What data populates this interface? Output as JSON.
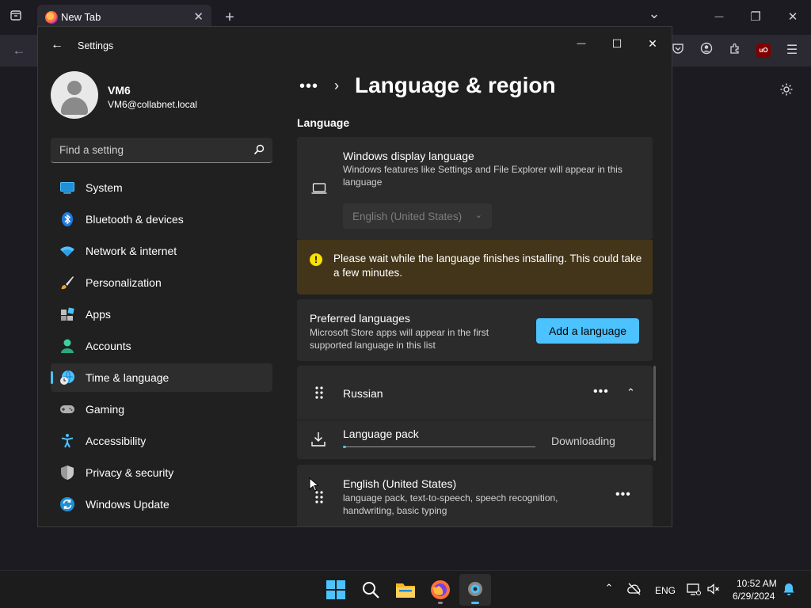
{
  "browser": {
    "tab_title": "New Tab",
    "tab_close": "✕",
    "new_tab": "+",
    "list_all_tabs": "⌄",
    "minimize": "—",
    "restore": "❐",
    "close": "✕",
    "back": "←",
    "menu": "☰",
    "ublock_label": "uO"
  },
  "settings": {
    "window_title": "Settings",
    "back": "←",
    "minimize": "—",
    "maximize": "☐",
    "close": "✕",
    "user": {
      "name": "VM6",
      "email": "VM6@collabnet.local"
    },
    "search": {
      "placeholder": "Find a setting"
    },
    "nav": [
      {
        "label": "System",
        "icon": "system-icon"
      },
      {
        "label": "Bluetooth & devices",
        "icon": "bluetooth-icon"
      },
      {
        "label": "Network & internet",
        "icon": "wifi-icon"
      },
      {
        "label": "Personalization",
        "icon": "brush-icon"
      },
      {
        "label": "Apps",
        "icon": "apps-icon"
      },
      {
        "label": "Accounts",
        "icon": "accounts-icon"
      },
      {
        "label": "Time & language",
        "icon": "time-language-icon",
        "active": true
      },
      {
        "label": "Gaming",
        "icon": "gamepad-icon"
      },
      {
        "label": "Accessibility",
        "icon": "accessibility-icon"
      },
      {
        "label": "Privacy & security",
        "icon": "shield-icon"
      },
      {
        "label": "Windows Update",
        "icon": "update-icon"
      }
    ],
    "breadcrumb": {
      "more": "•••",
      "separator": "›"
    },
    "page_title": "Language & region",
    "section_language": "Language",
    "display_language": {
      "title": "Windows display language",
      "description": "Windows features like Settings and File Explorer will appear in this language",
      "selected": "English (United States)"
    },
    "warning": "Please wait while the language finishes installing. This could take a few minutes.",
    "preferred": {
      "title": "Preferred languages",
      "description": "Microsoft Store apps will appear in the first supported language in this list",
      "add_button": "Add a language"
    },
    "languages": [
      {
        "name": "Russian",
        "pack_label": "Language pack",
        "pack_status": "Downloading",
        "pack_progress_percent": 1.5
      },
      {
        "name": "English (United States)",
        "features": "language pack, text-to-speech, speech recognition, handwriting, basic typing"
      }
    ],
    "more_options": "•••",
    "collapse": "⌃"
  },
  "taskbar": {
    "language": "ENG",
    "time": "10:52 AM",
    "date": "6/29/2024"
  },
  "colors": {
    "accent": "#4cc2ff",
    "warning_bg": "#433519",
    "warning_icon": "#fce100",
    "card_bg": "#2b2b2b",
    "window_bg": "#202020"
  }
}
